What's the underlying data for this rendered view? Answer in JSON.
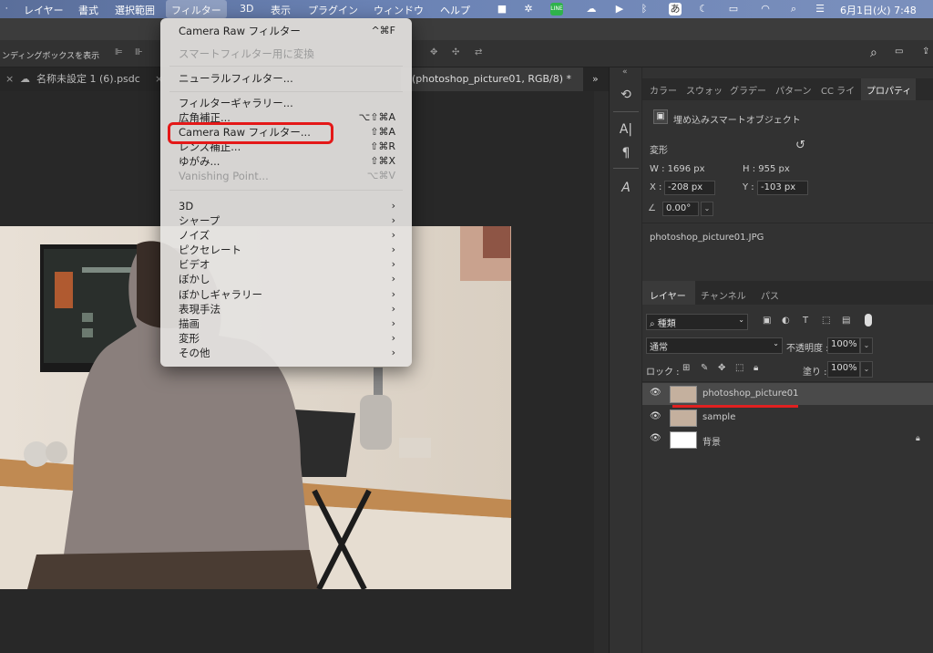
{
  "menubar": {
    "items": [
      "レイヤー",
      "書式",
      "選択範囲",
      "フィルター",
      "3D",
      "表示",
      "プラグイン",
      "ウィンドウ",
      "ヘルプ"
    ],
    "clock": "6月1日(火)  7:48"
  },
  "options_bar": {
    "bbox_label": "ンディングボックスを表示"
  },
  "tabs": {
    "tab1": "名称未設定 1 (6).psdc",
    "tab2": "(photoshop_picture01, RGB/8) *"
  },
  "filter_menu": {
    "last_filter": {
      "label": "Camera Raw フィルター",
      "shortcut": "^⌘F"
    },
    "convert_smart": "スマートフィルター用に変換",
    "neural": "ニューラルフィルター...",
    "gallery": "フィルターギャラリー...",
    "adaptive_wide": {
      "label": "広角補正...",
      "shortcut": "⌥⇧⌘A"
    },
    "camera_raw": {
      "label": "Camera Raw フィルター...",
      "shortcut": "⇧⌘A"
    },
    "lens": {
      "label": "レンズ補正...",
      "shortcut": "⇧⌘R"
    },
    "liquify": {
      "label": "ゆがみ...",
      "shortcut": "⇧⌘X"
    },
    "vanishing": {
      "label": "Vanishing Point...",
      "shortcut": "⌥⌘V"
    },
    "submenus": [
      "3D",
      "シャープ",
      "ノイズ",
      "ピクセレート",
      "ビデオ",
      "ぼかし",
      "ぼかしギャラリー",
      "表現手法",
      "描画",
      "変形",
      "その他"
    ]
  },
  "right_panel": {
    "tabs": [
      "カラー",
      "スウォッ",
      "グラデー",
      "パターン",
      "CC ライ",
      "プロパティ"
    ],
    "properties": {
      "type": "埋め込みスマートオブジェクト",
      "section": "変形",
      "w": "W :  1696 px",
      "h": "H :  955 px",
      "x_label": "X :",
      "x_value": "-208 px",
      "y_label": "Y :",
      "y_value": "-103 px",
      "angle": "0.00°",
      "filename": "photoshop_picture01.JPG"
    },
    "layers_tabs": [
      "レイヤー",
      "チャンネル",
      "パス"
    ],
    "filter_kind": "種類",
    "blend_mode": "通常",
    "opacity_label": "不透明度 :",
    "opacity": "100%",
    "lock_label": "ロック :",
    "fill_label": "塗り :",
    "fill": "100%",
    "layers": [
      "photoshop_picture01",
      "sample",
      "背景"
    ]
  }
}
